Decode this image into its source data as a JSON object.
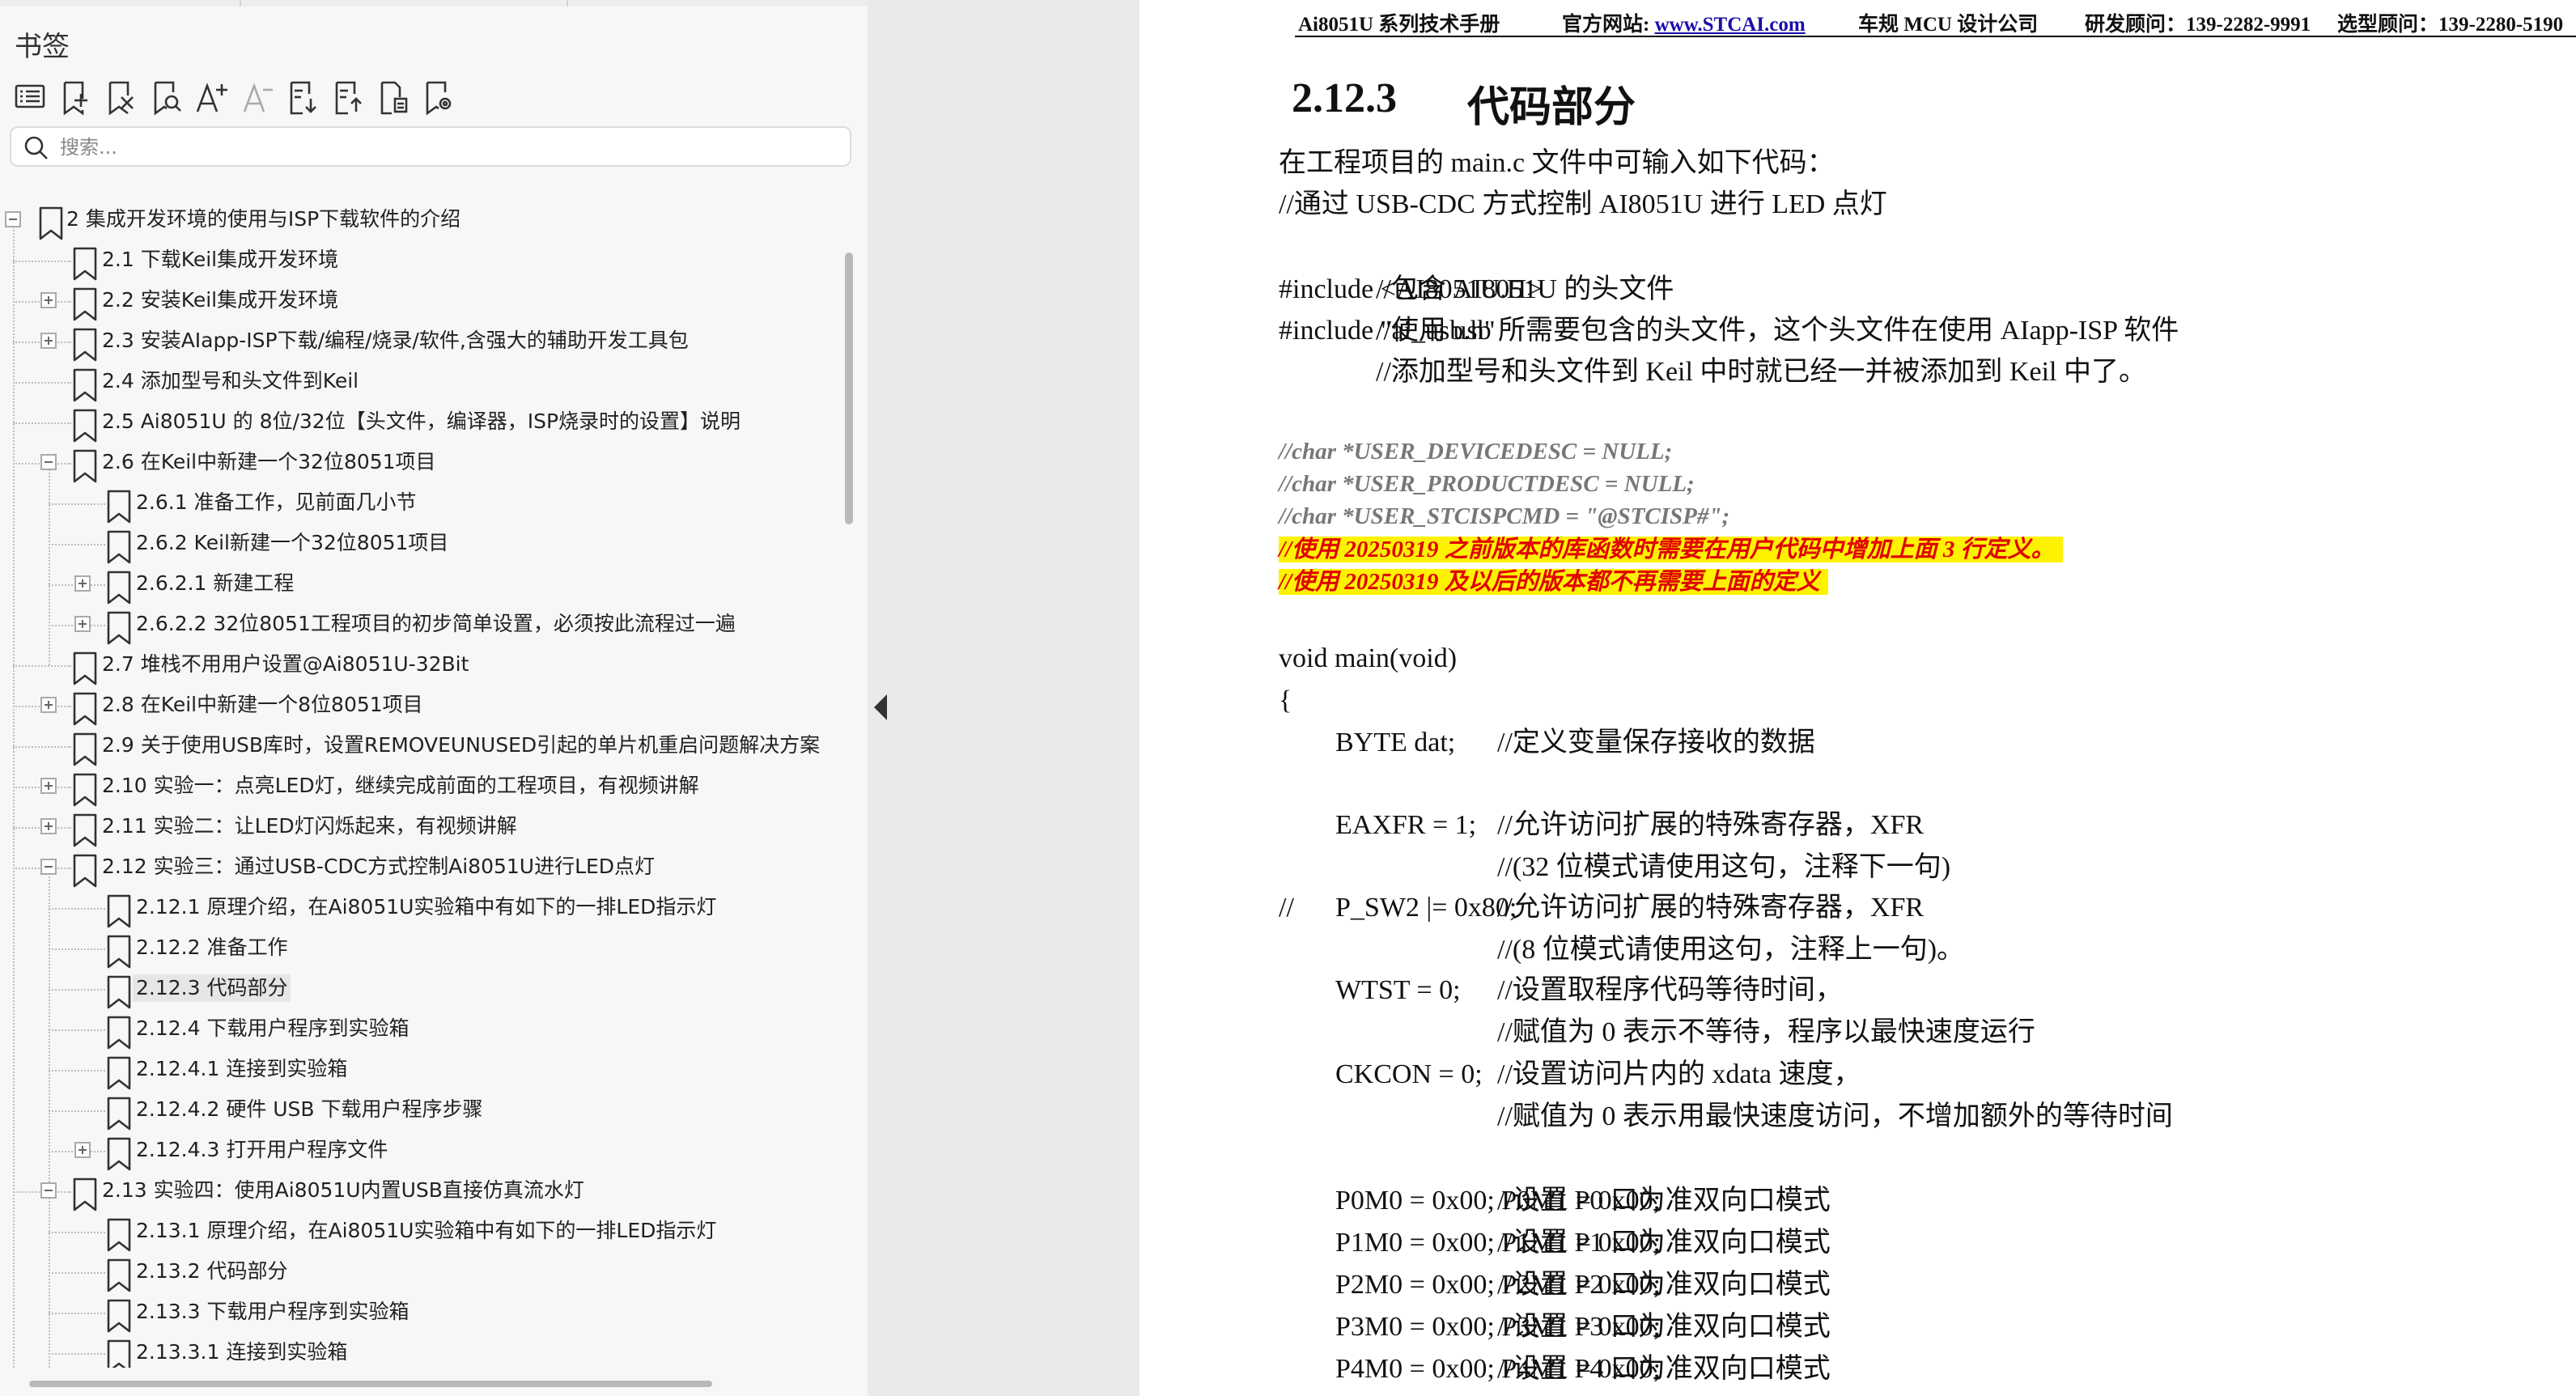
{
  "sidebar": {
    "title": "书签",
    "toolbar": [
      {
        "name": "list-icon"
      },
      {
        "name": "add-bookmark-icon"
      },
      {
        "name": "delete-bookmark-icon"
      },
      {
        "name": "find-bookmark-icon"
      },
      {
        "name": "enlarge-font-icon"
      },
      {
        "name": "shrink-font-icon"
      },
      {
        "name": "expand-all-icon"
      },
      {
        "name": "collapse-all-icon"
      },
      {
        "name": "bookmark-page-icon"
      },
      {
        "name": "bookmark-settings-icon"
      }
    ],
    "search_placeholder": "搜索...",
    "items": [
      {
        "label": "2  集成开发环境的使用与ISP下载软件的介绍"
      },
      {
        "label": "2.1 下载Keil集成开发环境"
      },
      {
        "label": "2.2  安装Keil集成开发环境"
      },
      {
        "label": "2.3  安装AIapp-ISP下载/编程/烧录/软件,含强大的辅助开发工具包"
      },
      {
        "label": "2.4  添加型号和头文件到Keil"
      },
      {
        "label": "2.5  Ai8051U 的 8位/32位【头文件，编译器，ISP烧录时的设置】说明"
      },
      {
        "label": "2.6 在Keil中新建一个32位8051项目"
      },
      {
        "label": "2.6.1 准备工作，见前面几小节"
      },
      {
        "label": "2.6.2  Keil新建一个32位8051项目"
      },
      {
        "label": "2.6.2.1 新建工程"
      },
      {
        "label": "2.6.2.2  32位8051工程项目的初步简单设置，必须按此流程过一遍"
      },
      {
        "label": "2.7 堆栈不用用户设置@Ai8051U-32Bit"
      },
      {
        "label": "2.8  在Keil中新建一个8位8051项目"
      },
      {
        "label": "2.9  关于使用USB库时，设置REMOVEUNUSED引起的单片机重启问题解决方案"
      },
      {
        "label": "2.10  实验一：点亮LED灯，继续完成前面的工程项目，有视频讲解"
      },
      {
        "label": "2.11  实验二：让LED灯闪烁起来，有视频讲解"
      },
      {
        "label": "2.12  实验三：通过USB-CDC方式控制Ai8051U进行LED点灯"
      },
      {
        "label": "2.12.1 原理介绍，在Ai8051U实验箱中有如下的一排LED指示灯"
      },
      {
        "label": "2.12.2  准备工作"
      },
      {
        "label": "2.12.3  代码部分"
      },
      {
        "label": "2.12.4  下载用户程序到实验箱"
      },
      {
        "label": "2.12.4.1 连接到实验箱"
      },
      {
        "label": "2.12.4.2 硬件 USB 下载用户程序步骤"
      },
      {
        "label": "2.12.4.3  打开用户程序文件"
      },
      {
        "label": "2.13 实验四：使用Ai8051U内置USB直接仿真流水灯"
      },
      {
        "label": "2.13.1 原理介绍，在Ai8051U实验箱中有如下的一排LED指示灯"
      },
      {
        "label": "2.13.2 代码部分"
      },
      {
        "label": "2.13.3  下载用户程序到实验箱"
      },
      {
        "label": "2.13.3.1 连接到实验箱"
      }
    ]
  },
  "document": {
    "header": {
      "manual": "Ai8051U 系列技术手册",
      "website_label": "官方网站: ",
      "website": "www.STCAI.com",
      "company": "车规 MCU 设计公司",
      "rd_contact": "研发顾问：139-2282-9991",
      "sales_contact": "选型顾问：139-2280-5190"
    },
    "section_number": "2.12.3",
    "section_title": "代码部分",
    "lines": [
      {
        "text": "在工程项目的 main.c 文件中可输入如下代码："
      },
      {
        "text": "//通过 USB-CDC 方式控制 AI8051U 进行 LED 点灯"
      },
      {
        "code": "#include <AI8051U.H>",
        "comment": "//包含 AI8051U 的头文件"
      },
      {
        "code": "#include \"ai_usb.h\"",
        "comment": "//使用 usb 所需要包含的头文件，这个头文件在使用 AIapp-ISP 软件"
      },
      {
        "comment": "//添加型号和头文件到 Keil 中时就已经一并被添加到 Keil 中了。"
      },
      {
        "text": "//char *USER_DEVICEDESC = NULL;"
      },
      {
        "text": "//char *USER_PRODUCTDESC = NULL;"
      },
      {
        "text": "//char *USER_STCISPCMD = \"@STCISP#\";"
      },
      {
        "text": "//使用 20250319 之前版本的库函数时需要在用户代码中增加上面 3 行定义。"
      },
      {
        "text": "//使用 20250319 及以后的版本都不再需要上面的定义"
      },
      {
        "code": "void main(void)"
      },
      {
        "code": "{"
      },
      {
        "code": "BYTE dat;",
        "comment": "//定义变量保存接收的数据"
      },
      {
        "code": "EAXFR = 1;",
        "comment": "//允许访问扩展的特殊寄存器，XFR"
      },
      {
        "comment": "//(32 位模式请使用这句，注释下一句)"
      },
      {
        "prefix": "//",
        "code": "P_SW2 |= 0x80;",
        "comment": "//允许访问扩展的特殊寄存器，XFR"
      },
      {
        "comment": "//(8 位模式请使用这句，注释上一句)。"
      },
      {
        "code": "WTST = 0;",
        "comment": "//设置取程序代码等待时间，"
      },
      {
        "comment": "//赋值为  0 表示不等待，程序以最快速度运行"
      },
      {
        "code": "CKCON = 0;",
        "comment": "//设置访问片内的  xdata 速度，"
      },
      {
        "comment": "//赋值为  0 表示用最快速度访问，不增加额外的等待时间"
      },
      {
        "code": "P0M0 = 0x00; P0M1 = 0x00;",
        "comment": "//设置 P0 口为准双向口模式"
      },
      {
        "code": "P1M0 = 0x00; P1M1 = 0x00;",
        "comment": "//设置 P1 口为准双向口模式"
      },
      {
        "code": "P2M0 = 0x00; P2M1 = 0x00;",
        "comment": "//设置 P2 口为准双向口模式"
      },
      {
        "code": "P3M0 = 0x00; P3M1 = 0x00;",
        "comment": "//设置 P3 口为准双向口模式"
      },
      {
        "code": "P4M0 = 0x00; P4M1 = 0x00;",
        "comment": "//设置 P4 口为准双向口模式"
      }
    ]
  },
  "colors": {
    "highlight": "#fff200",
    "highlight_text": "#e00000",
    "link": "#1a0dab"
  }
}
